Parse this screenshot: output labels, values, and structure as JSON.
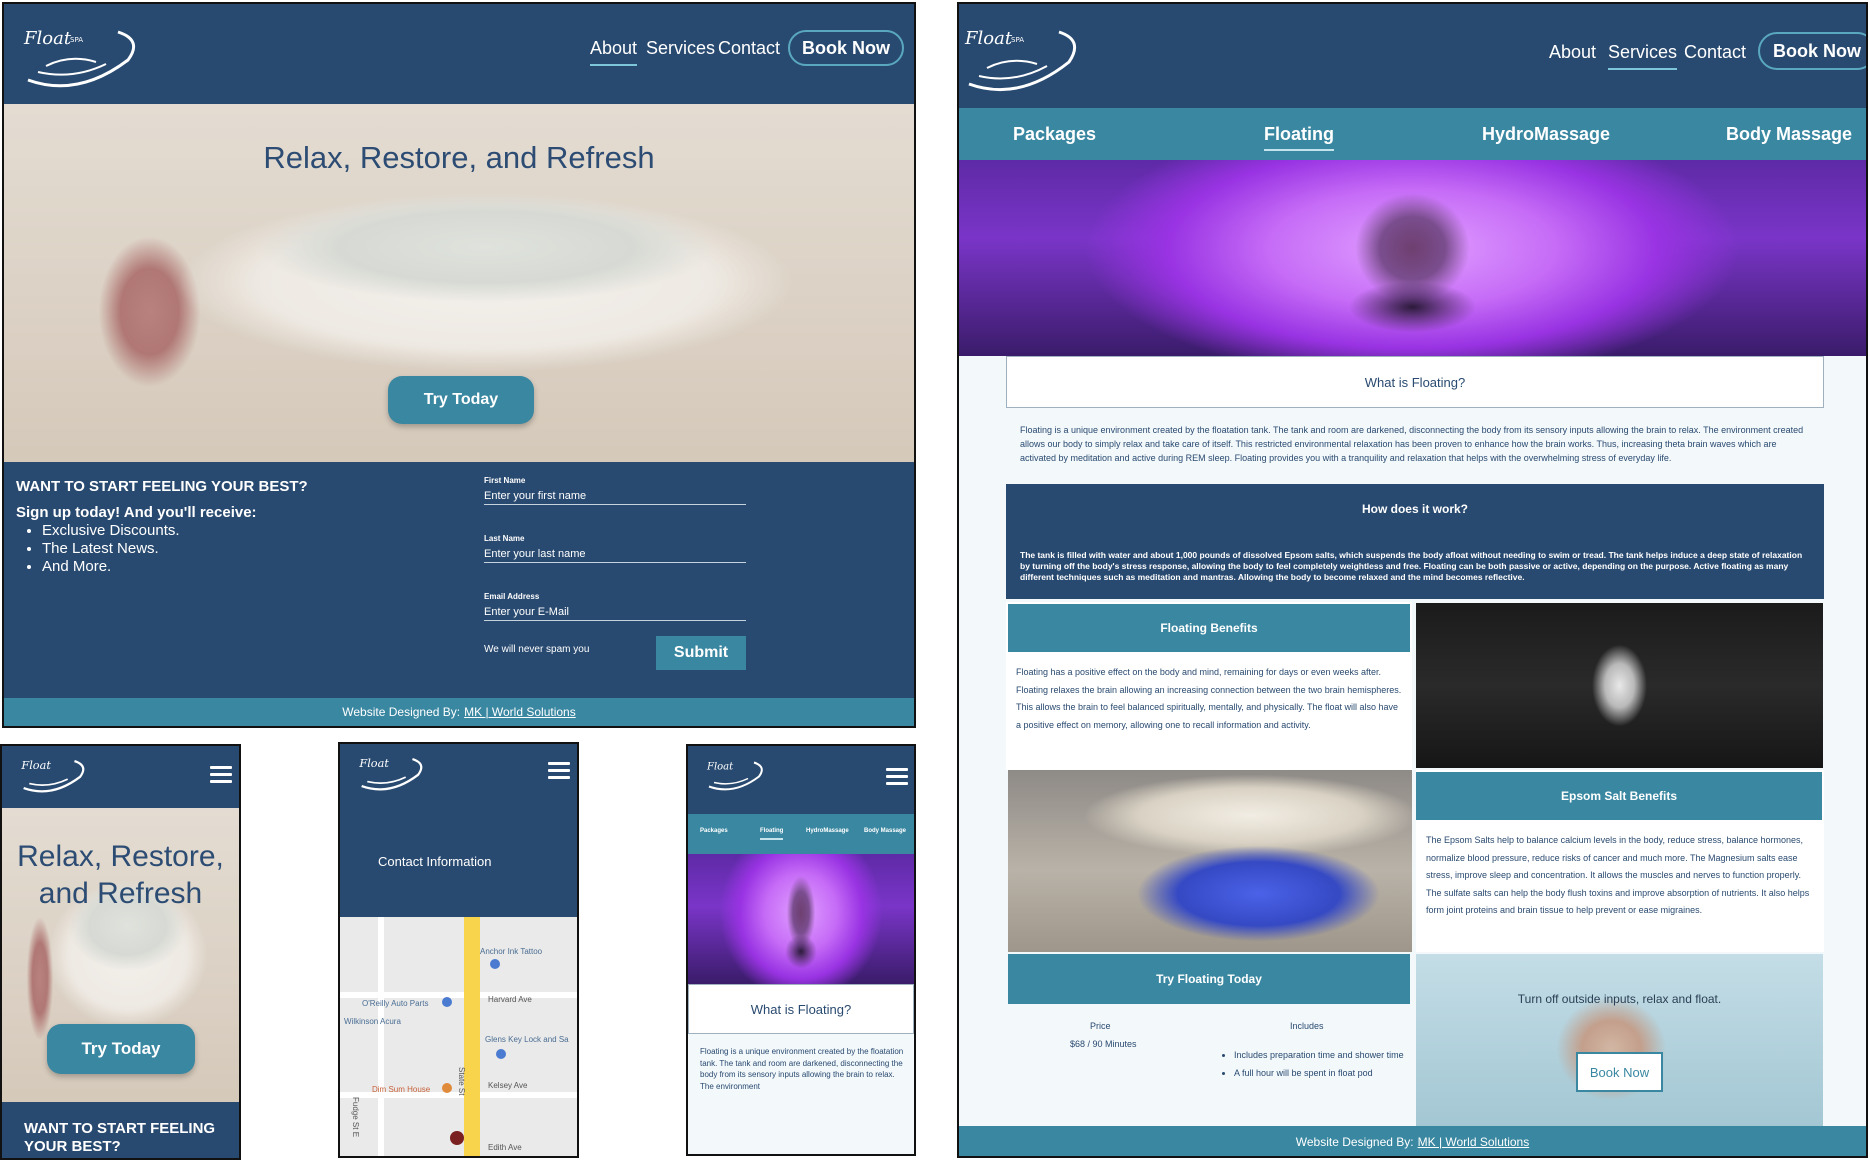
{
  "brand": {
    "logo_text": "Float",
    "logo_sub": "SPA"
  },
  "home": {
    "nav": [
      "About",
      "Services",
      "Contact"
    ],
    "book_now": "Book Now",
    "hero_title": "Relax, Restore, and Refresh",
    "try_today": "Try Today",
    "signup_heading": "WANT TO START FEELING YOUR BEST?",
    "signup_sub": "Sign up today! And you'll receive:",
    "benefits": [
      "Exclusive Discounts.",
      "The Latest News.",
      "And More."
    ],
    "form": {
      "first_label": "First Name",
      "first_placeholder": "Enter your first name",
      "last_label": "Last Name",
      "last_placeholder": "Enter your last name",
      "email_label": "Email Address",
      "email_placeholder": "Enter your E-Mail",
      "spam_note": "We will never spam you",
      "submit": "Submit"
    },
    "footer_prefix": "Website Designed By:",
    "footer_link": "MK | World Solutions"
  },
  "services": {
    "nav": [
      "About",
      "Services",
      "Contact"
    ],
    "book_now": "Book Now",
    "tabs": [
      "Packages",
      "Floating",
      "HydroMassage",
      "Body Massage"
    ],
    "what_title": "What is Floating?",
    "what_body": "Floating is a unique environment created by the floatation tank. The tank and room are darkened, disconnecting the body from its sensory inputs allowing the brain to relax. The environment created allows our body to simply relax and take care of itself. This restricted environmental relaxation has been proven to enhance how the brain works. Thus, increasing theta brain waves which are activated by meditation and active during REM sleep. Floating provides you with a tranquility and relaxation that helps with the overwhelming stress of everyday life.",
    "how_title": "How does it work?",
    "how_body": "The tank is filled with water and about 1,000 pounds of dissolved Epsom salts, which suspends the body afloat without needing to swim or tread. The tank helps induce a deep state of relaxation by turning off the body's stress response, allowing the body to feel completely weightless and free. Floating can be both passive or active, depending on the purpose. Active floating as many different techniques such as meditation and mantras. Allowing the body to become relaxed and the mind becomes reflective.",
    "benefits_title": "Floating Benefits",
    "benefits_body": "Floating has a positive effect on the body and mind, remaining for days or even weeks after. Floating relaxes the brain allowing an increasing connection between the two brain hemispheres. This allows the brain to feel balanced spiritually, mentally, and physically. The float will also have a positive effect on memory, allowing one to recall information and activity.",
    "epsom_title": "Epsom Salt Benefits",
    "epsom_body": "The Epsom Salts help to balance calcium levels in the body, reduce stress, balance hormones, normalize blood pressure, reduce risks of cancer and much more. The Magnesium salts ease stress, improve sleep and concentration. It allows the muscles and nerves to function properly. The sulfate salts can help the body flush toxins and improve absorption of nutrients. It also helps form joint proteins and brain tissue to help prevent or ease migraines.",
    "try_title": "Try Floating Today",
    "price_label": "Price",
    "price_value": "$68 / 90 Minutes",
    "includes_label": "Includes",
    "includes": [
      "Includes preparation time and shower time",
      "A full hour will be spent in float pod"
    ],
    "tagline": "Turn off outside inputs, relax and float.",
    "book_now_inline": "Book Now",
    "footer_prefix": "Website Designed By:",
    "footer_link": "MK | World Solutions"
  },
  "mobile_home": {
    "hero_title": "Relax, Restore, and Refresh",
    "try_today": "Try Today",
    "signup_heading": "WANT TO START FEELING YOUR BEST?"
  },
  "mobile_contact": {
    "title": "Contact Information",
    "map_labels": [
      "Anchor Ink Tattoo",
      "Harvard Ave",
      "O'Reilly Auto Parts",
      "Wilkinson Acura",
      "Glens Key Lock and Sa",
      "State St",
      "Dim Sum House",
      "Kelsey Ave",
      "Fudge St E",
      "Edith Ave"
    ]
  },
  "mobile_services": {
    "tabs": [
      "Packages",
      "Floating",
      "HydroMassage",
      "Body Massage"
    ],
    "what_title": "What is Floating?",
    "what_body": "Floating is a unique environment created by the floatation tank. The tank and room are darkened, disconnecting the body from its sensory inputs allowing the brain to relax. The environment"
  },
  "colors": {
    "navy": "#294a70",
    "teal": "#3a87a1"
  },
  "icons": [
    "logo-icon",
    "hamburger-menu-icon",
    "map-pin-icon"
  ]
}
